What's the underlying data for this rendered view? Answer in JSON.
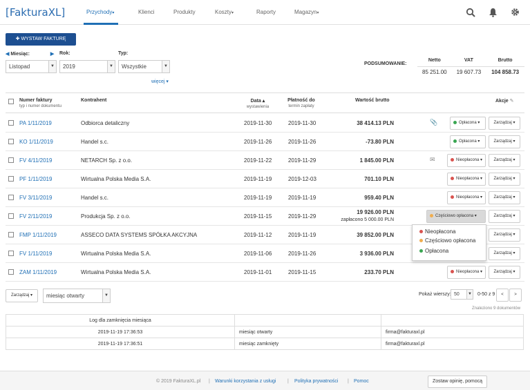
{
  "app": {
    "logo": "FakturaXL",
    "logo_prefix": "[",
    "logo_suffix": "]"
  },
  "nav": {
    "tabs": [
      "Przychody",
      "Klienci",
      "Produkty",
      "Koszty",
      "Raporty",
      "Magazyn"
    ]
  },
  "toolbar": {
    "new_invoice": "WYSTAW FAKTURĘ",
    "plus": "✚"
  },
  "filters": {
    "month_label": "Miesiąc:",
    "month_value": "Listopad",
    "year_label": "Rok:",
    "year_value": "2019",
    "type_label": "Typ:",
    "type_value": "Wszystkie",
    "more": "więcej"
  },
  "summary": {
    "label": "PODSUMOWANIE:",
    "headers": [
      "Netto",
      "VAT",
      "Brutto"
    ],
    "values": [
      "85 251.00",
      "19 607.73",
      "104 858.73"
    ]
  },
  "table": {
    "col_number": "Numer faktury",
    "col_number_sub": "typ i numer dokumentu",
    "col_client": "Kontrahent",
    "col_date": "Data ▴",
    "col_date_sub": "wystawienia",
    "col_due": "Płatność do",
    "col_due_sub": "termin zapłaty",
    "col_value": "Wartość brutto",
    "col_actions": "Akcje"
  },
  "rows": [
    {
      "number": "PA 1/11/2019",
      "client": "Odbiorca detaliczny",
      "date": "2019-11-30",
      "due": "2019-11-30",
      "value": "38 414.13 PLN",
      "status": "Opłacona",
      "manage": "Zarządzaj",
      "icon": "📎"
    },
    {
      "number": "KO 1/11/2019",
      "client": "Handel s.c.",
      "date": "2019-11-26",
      "due": "2019-11-26",
      "value": "-73.80 PLN",
      "status": "Opłacona",
      "manage": "Zarządzaj",
      "icon": ""
    },
    {
      "number": "FV 4/11/2019",
      "client": "NETARCH Sp. z o.o.",
      "date": "2019-11-22",
      "due": "2019-11-29",
      "value": "1 845.00 PLN",
      "status": "Nieopłacona",
      "manage": "Zarządzaj",
      "icon": "✉"
    },
    {
      "number": "PF 1/11/2019",
      "client": "Wirtualna Polska Media S.A.",
      "date": "2019-11-19",
      "due": "2019-12-03",
      "value": "701.10 PLN",
      "status": "Nieopłacona",
      "manage": "Zarządzaj",
      "icon": ""
    },
    {
      "number": "FV 3/11/2019",
      "client": "Handel s.c.",
      "date": "2019-11-19",
      "due": "2019-11-19",
      "value": "959.40 PLN",
      "status": "Nieopłacona",
      "manage": "Zarządzaj",
      "icon": ""
    },
    {
      "number": "FV 2/11/2019",
      "client": "Produkcja Sp. z o.o.",
      "date": "2019-11-15",
      "due": "2019-11-29",
      "value": "19 926.00 PLN",
      "value_sub": "zapłacono 5 000.00 PLN",
      "status": "Częściowo opłacona",
      "manage": "Zarządzaj",
      "icon": ""
    },
    {
      "number": "FMP 1/11/2019",
      "client": "ASSECO DATA SYSTEMS SPÓŁKA AKCYJNA",
      "date": "2019-11-12",
      "due": "2019-11-19",
      "value": "39 852.00 PLN",
      "status": "",
      "manage": "Zarządzaj",
      "icon": ""
    },
    {
      "number": "FV 1/11/2019",
      "client": "Wirtualna Polska Media S.A.",
      "date": "2019-11-06",
      "due": "2019-11-26",
      "value": "3 936.00 PLN",
      "status": "",
      "manage": "Zarządzaj",
      "icon": ""
    },
    {
      "number": "ZAM 1/11/2019",
      "client": "Wirtualna Polska Media S.A.",
      "date": "2019-11-01",
      "due": "2019-11-15",
      "value": "233.70 PLN",
      "status": "Nieopłacona",
      "manage": "Zarządzaj",
      "icon": ""
    }
  ],
  "status_menu": {
    "items": [
      "Nieopłacona",
      "Częściowo opłacona",
      "Opłacona"
    ]
  },
  "colors": {
    "paid": "#3aa652",
    "unpaid": "#d9534f",
    "partial": "#f0ad4e",
    "primary": "#1d4f91",
    "link": "#1f6fb5"
  },
  "bottom": {
    "manage": "Zarządzaj",
    "month_state": "miesiąc otwarty",
    "rows_label": "Pokaż wierszy:",
    "rows_value": "50",
    "range": "0-50 z 9",
    "prev": "<",
    "next": ">",
    "found": "Znaleziono 9 dokumentów"
  },
  "log": {
    "header": "Log dla zamknięcia miesiąca",
    "rows": [
      {
        "time": "2019-11-19 17:36:53",
        "action": "miesiąc otwarty",
        "user": "firma@fakturaxl.pl"
      },
      {
        "time": "2019-11-19 17:36:51",
        "action": "miesiąc zamknięty",
        "user": "firma@fakturaxl.pl"
      }
    ]
  },
  "footer": {
    "copyright": "© 2019 FakturaXL.pl",
    "links": [
      "Warunki korzystania z usługi",
      "Polityka prywatności",
      "Pomoc"
    ],
    "feedback": "Zostaw opinię, pomocą"
  }
}
